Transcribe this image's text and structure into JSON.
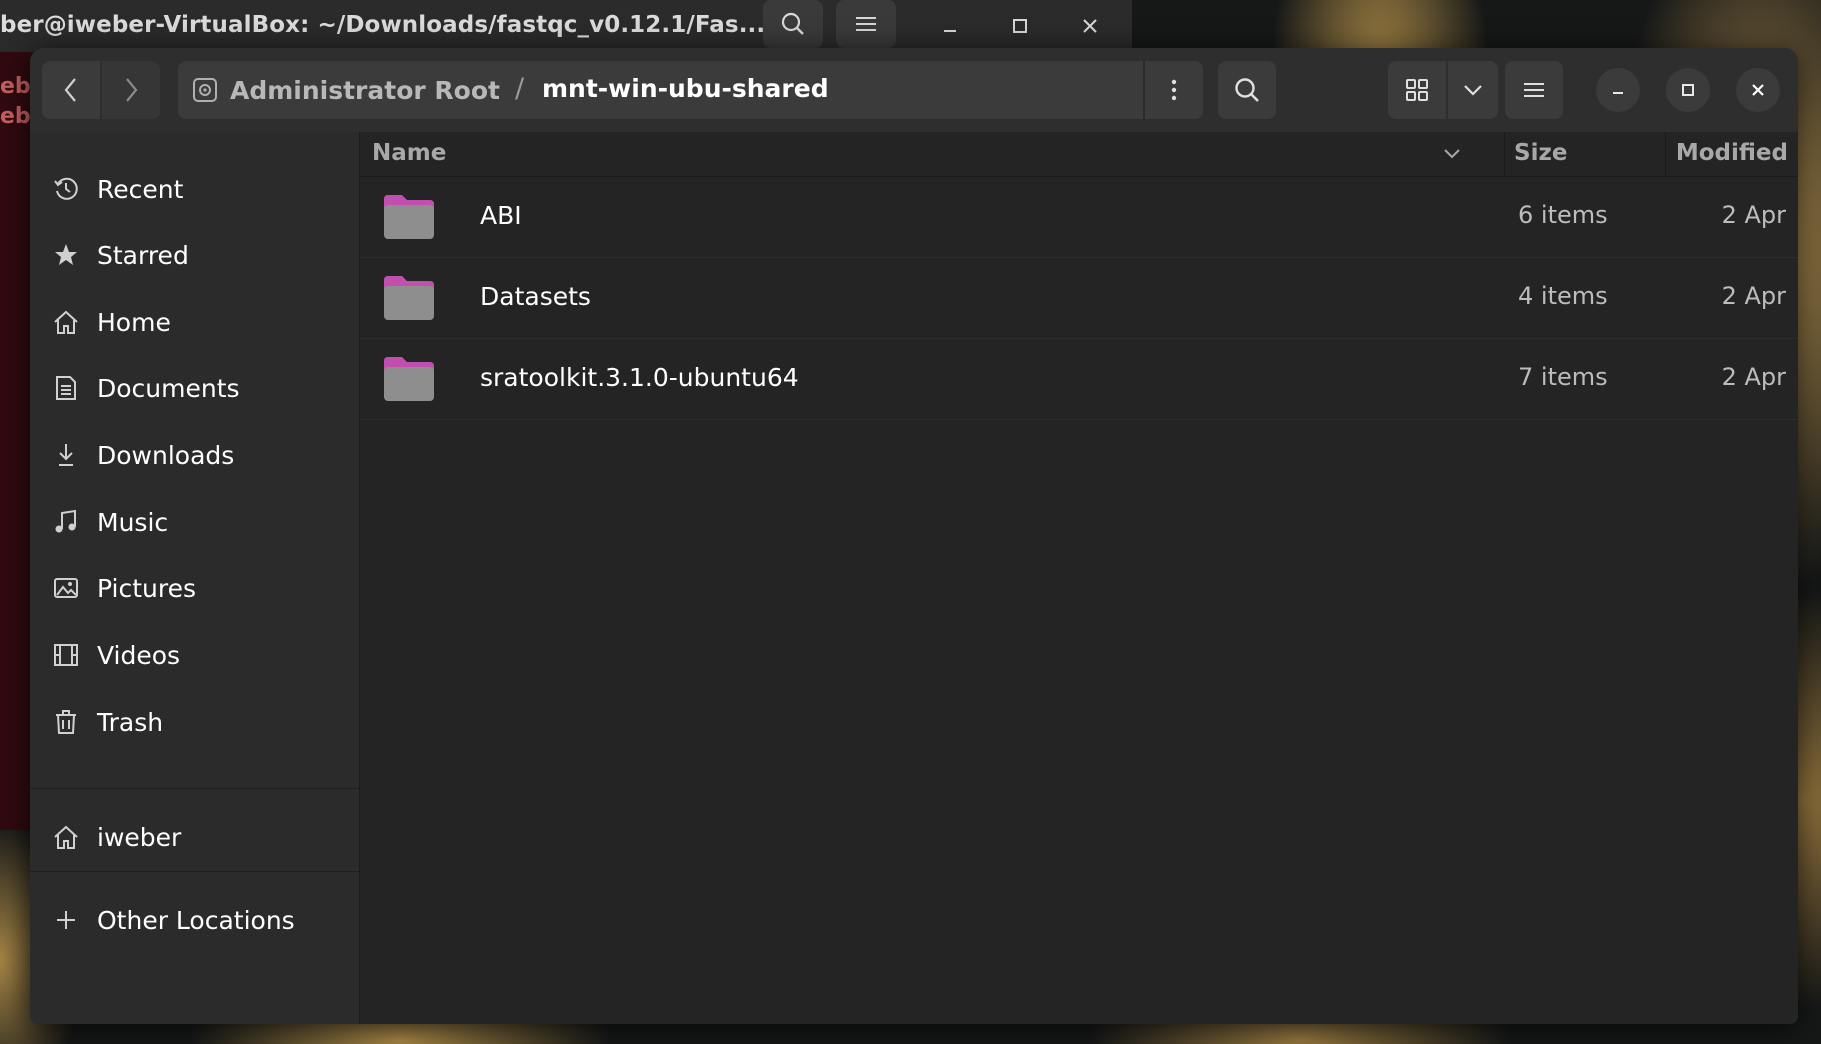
{
  "terminal": {
    "title": "ber@iweber-VirtualBox: ~/Downloads/fastqc_v0.12.1/Fas...",
    "side_text": [
      "ebe",
      "ebe"
    ]
  },
  "window": {
    "path": {
      "root_label": "Administrator Root",
      "separator": "/",
      "current": "mnt-win-ubu-shared"
    }
  },
  "sidebar": {
    "items": [
      {
        "label": "Recent",
        "icon": "clock-icon"
      },
      {
        "label": "Starred",
        "icon": "star-icon"
      },
      {
        "label": "Home",
        "icon": "home-icon"
      },
      {
        "label": "Documents",
        "icon": "document-icon"
      },
      {
        "label": "Downloads",
        "icon": "download-icon"
      },
      {
        "label": "Music",
        "icon": "music-icon"
      },
      {
        "label": "Pictures",
        "icon": "picture-icon"
      },
      {
        "label": "Videos",
        "icon": "video-icon"
      },
      {
        "label": "Trash",
        "icon": "trash-icon"
      }
    ],
    "bookmarks": [
      {
        "label": "iweber",
        "icon": "home-icon"
      }
    ],
    "other": {
      "label": "Other Locations",
      "icon": "plus-icon"
    }
  },
  "columns": {
    "name": "Name",
    "size": "Size",
    "modified": "Modified"
  },
  "files": [
    {
      "name": "ABI",
      "size": "6 items",
      "modified": "2 Apr"
    },
    {
      "name": "Datasets",
      "size": "4 items",
      "modified": "2 Apr"
    },
    {
      "name": "sratoolkit.3.1.0-ubuntu64",
      "size": "7 items",
      "modified": "2 Apr"
    }
  ],
  "colors": {
    "folder_tab": "#c04fb0",
    "folder_body": "#8e8e8e",
    "window_bg": "#242424",
    "header_bg": "#2e2e2e",
    "sidebar_bg": "#2b2b2b"
  }
}
